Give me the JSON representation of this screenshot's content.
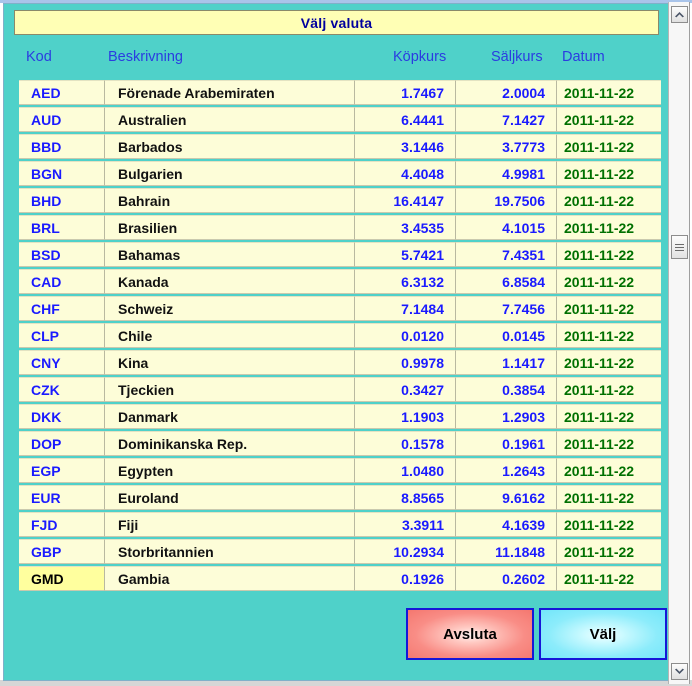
{
  "window": {
    "title": "Välj valuta",
    "background_color": "#4fd1c9",
    "titlebar_color": "#ffffb5",
    "title_text_color": "#00009e"
  },
  "table": {
    "columns": [
      {
        "key": "code",
        "label": "Kod"
      },
      {
        "key": "desc",
        "label": "Beskrivning"
      },
      {
        "key": "buy",
        "label": "Köpkurs"
      },
      {
        "key": "sell",
        "label": "Säljkurs"
      },
      {
        "key": "date",
        "label": "Datum"
      }
    ],
    "selected_row_index": 20,
    "rows": [
      {
        "code": "AED",
        "desc": "Förenade Arabemiraten",
        "buy": "1.7467",
        "sell": "2.0004",
        "date": "2011-11-22"
      },
      {
        "code": "AUD",
        "desc": "Australien",
        "buy": "6.4441",
        "sell": "7.1427",
        "date": "2011-11-22"
      },
      {
        "code": "BBD",
        "desc": "Barbados",
        "buy": "3.1446",
        "sell": "3.7773",
        "date": "2011-11-22"
      },
      {
        "code": "BGN",
        "desc": "Bulgarien",
        "buy": "4.4048",
        "sell": "4.9981",
        "date": "2011-11-22"
      },
      {
        "code": "BHD",
        "desc": "Bahrain",
        "buy": "16.4147",
        "sell": "19.7506",
        "date": "2011-11-22"
      },
      {
        "code": "BRL",
        "desc": "Brasilien",
        "buy": "3.4535",
        "sell": "4.1015",
        "date": "2011-11-22"
      },
      {
        "code": "BSD",
        "desc": "Bahamas",
        "buy": "5.7421",
        "sell": "7.4351",
        "date": "2011-11-22"
      },
      {
        "code": "CAD",
        "desc": "Kanada",
        "buy": "6.3132",
        "sell": "6.8584",
        "date": "2011-11-22"
      },
      {
        "code": "CHF",
        "desc": "Schweiz",
        "buy": "7.1484",
        "sell": "7.7456",
        "date": "2011-11-22"
      },
      {
        "code": "CLP",
        "desc": "Chile",
        "buy": "0.0120",
        "sell": "0.0145",
        "date": "2011-11-22"
      },
      {
        "code": "CNY",
        "desc": "Kina",
        "buy": "0.9978",
        "sell": "1.1417",
        "date": "2011-11-22"
      },
      {
        "code": "CZK",
        "desc": "Tjeckien",
        "buy": "0.3427",
        "sell": "0.3854",
        "date": "2011-11-22"
      },
      {
        "code": "DKK",
        "desc": "Danmark",
        "buy": "1.1903",
        "sell": "1.2903",
        "date": "2011-11-22"
      },
      {
        "code": "DOP",
        "desc": "Dominikanska Rep.",
        "buy": "0.1578",
        "sell": "0.1961",
        "date": "2011-11-22"
      },
      {
        "code": "EGP",
        "desc": "Egypten",
        "buy": "1.0480",
        "sell": "1.2643",
        "date": "2011-11-22"
      },
      {
        "code": "EUR",
        "desc": "Euroland",
        "buy": "8.8565",
        "sell": "9.6162",
        "date": "2011-11-22"
      },
      {
        "code": "FJD",
        "desc": "Fiji",
        "buy": "3.3911",
        "sell": "4.1639",
        "date": "2011-11-22"
      },
      {
        "code": "GBP",
        "desc": "Storbritannien",
        "buy": "10.2934",
        "sell": "11.1848",
        "date": "2011-11-22"
      },
      {
        "code": "GMD",
        "desc": "Gambia",
        "buy": "0.1926",
        "sell": "0.2602",
        "date": "2011-11-22"
      }
    ]
  },
  "buttons": {
    "cancel_label": "Avsluta",
    "select_label": "Välj",
    "cancel_color": "#f4776f",
    "select_color": "#72e6fa",
    "border_color": "#1616d8"
  },
  "scrollbar": {
    "up_icon": "chevron-up-icon",
    "down_icon": "chevron-down-icon",
    "thumb_icon": "grip-icon"
  }
}
